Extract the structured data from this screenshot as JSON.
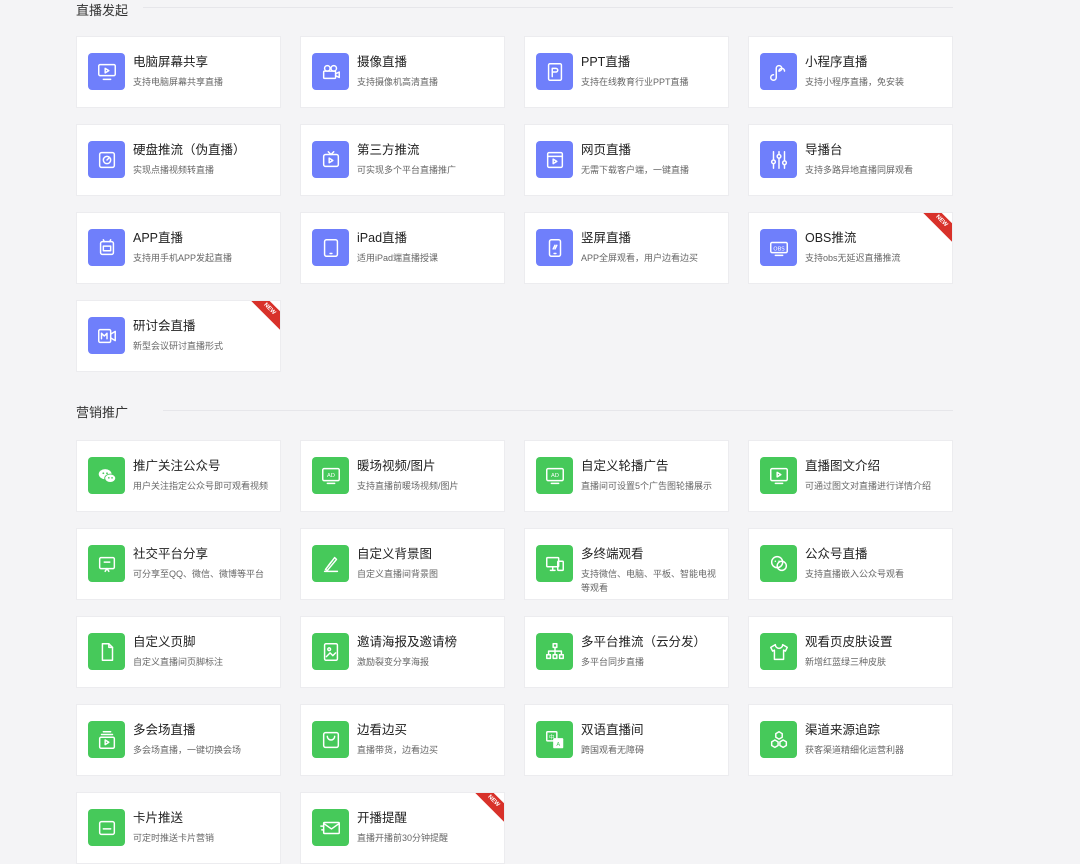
{
  "sections": {
    "live_start": {
      "title": "直播发起"
    },
    "marketing": {
      "title": "营销推广"
    }
  },
  "badge_label": "NEW",
  "live_start": [
    {
      "title": "电脑屏幕共享",
      "desc": "支持电脑屏幕共享直播",
      "icon": "monitor-icon"
    },
    {
      "title": "摄像直播",
      "desc": "支持摄像机高清直播",
      "icon": "camera-icon"
    },
    {
      "title": "PPT直播",
      "desc": "支持在线教育行业PPT直播",
      "icon": "ppt-icon"
    },
    {
      "title": "小程序直播",
      "desc": "支持小程序直播，免安装",
      "icon": "mini-program-icon"
    },
    {
      "title": "硬盘推流（伪直播）",
      "desc": "实现点播视频转直播",
      "icon": "disk-icon"
    },
    {
      "title": "第三方推流",
      "desc": "可实现多个平台直播推广",
      "icon": "tv-icon"
    },
    {
      "title": "网页直播",
      "desc": "无需下载客户端，一键直播",
      "icon": "web-icon"
    },
    {
      "title": "导播台",
      "desc": "支持多路异地直播同屏观看",
      "icon": "sliders-icon"
    },
    {
      "title": "APP直播",
      "desc": "支持用手机APP发起直播",
      "icon": "app-icon"
    },
    {
      "title": "iPad直播",
      "desc": "适用iPad端直播授课",
      "icon": "ipad-icon"
    },
    {
      "title": "竖屏直播",
      "desc": "APP全屏观看，用户边看边买",
      "icon": "phone-icon"
    },
    {
      "title": "OBS推流",
      "desc": "支持obs无延迟直播推流",
      "icon": "obs-icon",
      "badge": true
    },
    {
      "title": "研讨会直播",
      "desc": "新型会议研讨直播形式",
      "icon": "meeting-icon",
      "badge": true
    }
  ],
  "marketing": [
    {
      "title": "推广关注公众号",
      "desc": "用户关注指定公众号即可观看视频",
      "icon": "wechat-icon"
    },
    {
      "title": "暖场视频/图片",
      "desc": "支持直播前暖场视频/图片",
      "icon": "ad-icon"
    },
    {
      "title": "自定义轮播广告",
      "desc": "直播间可设置5个广告图轮播展示",
      "icon": "ad-icon"
    },
    {
      "title": "直播图文介绍",
      "desc": "可通过图文对直播进行详情介绍",
      "icon": "screen-play-icon"
    },
    {
      "title": "社交平台分享",
      "desc": "可分享至QQ、微信、微博等平台",
      "icon": "share-icon"
    },
    {
      "title": "自定义背景图",
      "desc": "自定义直播间背景图",
      "icon": "pen-icon"
    },
    {
      "title": "多终端观看",
      "desc": "支持微信、电脑、平板、智能电视等观看",
      "icon": "devices-icon"
    },
    {
      "title": "公众号直播",
      "desc": "支持直播嵌入公众号观看",
      "icon": "official-account-icon"
    },
    {
      "title": "自定义页脚",
      "desc": "自定义直播间页脚标注",
      "icon": "page-icon"
    },
    {
      "title": "邀请海报及邀请榜",
      "desc": "激励裂变分享海报",
      "icon": "poster-icon"
    },
    {
      "title": "多平台推流（云分发）",
      "desc": "多平台同步直播",
      "icon": "network-icon"
    },
    {
      "title": "观看页皮肤设置",
      "desc": "新增红蓝绿三种皮肤",
      "icon": "shirt-icon"
    },
    {
      "title": "多会场直播",
      "desc": "多会场直播，一键切换会场",
      "icon": "venue-icon"
    },
    {
      "title": "边看边买",
      "desc": "直播带货，边看边买",
      "icon": "bag-icon"
    },
    {
      "title": "双语直播间",
      "desc": "跨国观看无障碍",
      "icon": "translate-icon"
    },
    {
      "title": "渠道来源追踪",
      "desc": "获客渠道精细化运营利器",
      "icon": "hexagons-icon"
    },
    {
      "title": "卡片推送",
      "desc": "可定时推送卡片营销",
      "icon": "card-icon"
    },
    {
      "title": "开播提醒",
      "desc": "直播开播前30分钟提醒",
      "icon": "mail-icon",
      "badge": true
    }
  ]
}
